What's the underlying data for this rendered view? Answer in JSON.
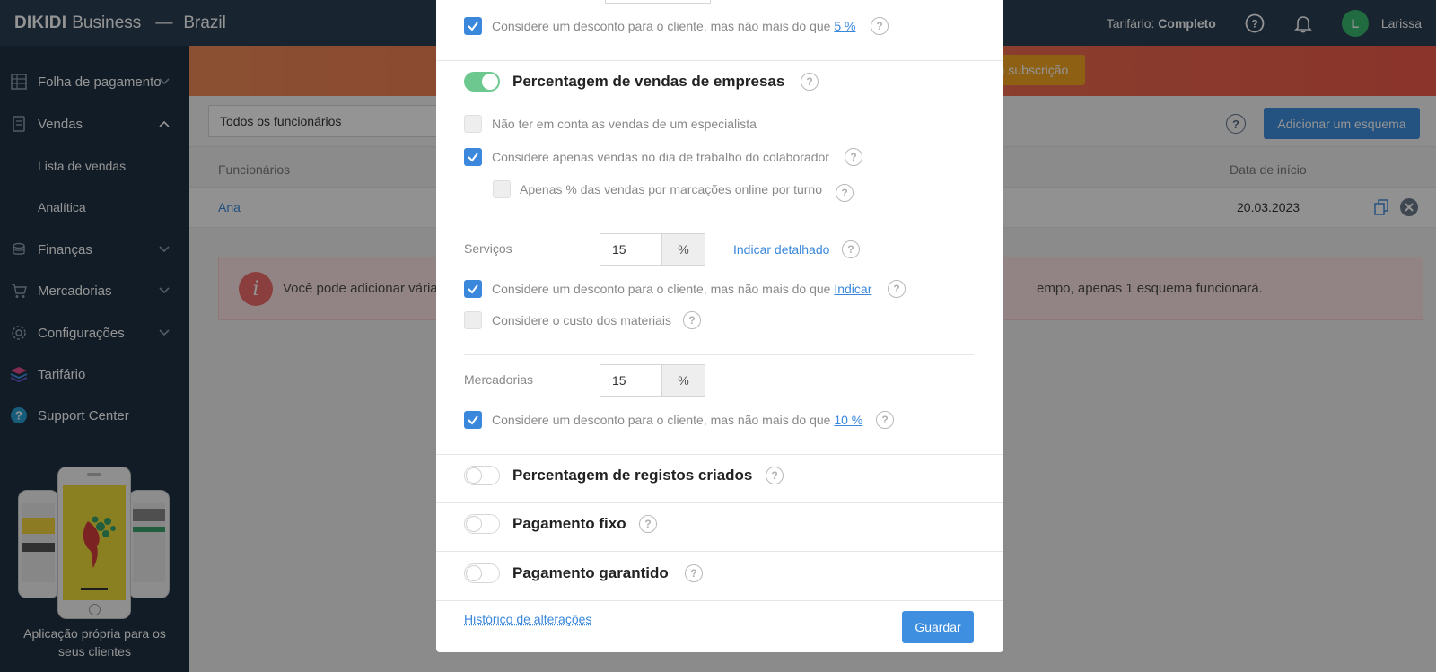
{
  "topbar": {
    "brand_bold": "DIKIDI",
    "brand_thin": "Business",
    "separator": "—",
    "region": "Brazil",
    "tariff_label": "Tarifário:",
    "tariff_value": "Completo",
    "user_initial": "L",
    "user_name": "Larissa"
  },
  "sidebar": {
    "items": [
      {
        "label": "Folha de pagamento"
      },
      {
        "label": "Vendas"
      },
      {
        "label": "Finanças"
      },
      {
        "label": "Mercadorias"
      },
      {
        "label": "Configurações"
      },
      {
        "label": "Tarifário"
      },
      {
        "label": "Support Center"
      }
    ],
    "sub_items": [
      {
        "label": "Lista de vendas"
      },
      {
        "label": "Analítica"
      }
    ],
    "promo_line1": "Aplicação própria para os",
    "promo_line2": "seus clientes"
  },
  "main": {
    "banner_button": "a subscrição",
    "employee_filter": "Todos os funcionários",
    "add_scheme_button": "Adicionar um esquema",
    "columns": {
      "employees": "Funcionários",
      "start_date": "Data de início"
    },
    "row": {
      "employee": "Ana",
      "start_date": "20.03.2023"
    },
    "info_text_left": "Você pode adicionar vária",
    "info_text_right": "empo, apenas 1 esquema funcionará."
  },
  "modal": {
    "top_discount": {
      "text": "Considere um desconto para o cliente, mas não mais do que ",
      "link": "5 %",
      "checked": true
    },
    "sales_section": {
      "title": "Percentagem de vendas de empresas",
      "enabled": true,
      "opt_ignore_specialist": {
        "text": "Não ter em conta as vendas de um especialista",
        "checked": false
      },
      "opt_working_day": {
        "text": "Considere apenas vendas no dia de trabalho do colaborador",
        "checked": true
      },
      "opt_online_only": {
        "text": "Apenas % das vendas por marcações online por turno",
        "checked": false
      },
      "services": {
        "label": "Serviços",
        "value": "15",
        "unit": "%",
        "detail_link": "Indicar detalhado",
        "discount": {
          "text": "Considere um desconto para o cliente, mas não mais do que ",
          "link": "Indicar",
          "checked": true
        },
        "materials": {
          "text": "Considere o custo dos materiais",
          "checked": false
        }
      },
      "goods": {
        "label": "Mercadorias",
        "value": "15",
        "unit": "%",
        "discount": {
          "text": "Considere um desconto para o cliente, mas não mais do que ",
          "link": "10 %",
          "checked": true
        }
      }
    },
    "records_section": {
      "title": "Percentagem de registos criados",
      "enabled": false
    },
    "fixed_section": {
      "title": "Pagamento fixo",
      "enabled": false
    },
    "guaranteed_section": {
      "title": "Pagamento garantido",
      "enabled": false
    },
    "history_link": "Histórico de alterações",
    "save_button": "Guardar"
  },
  "colors": {
    "topbar": "#2a3f54",
    "sidebar": "#1f3142",
    "accent": "#3f8fe0",
    "toggle_on": "#6cc88f",
    "avatar": "#37b86f"
  }
}
